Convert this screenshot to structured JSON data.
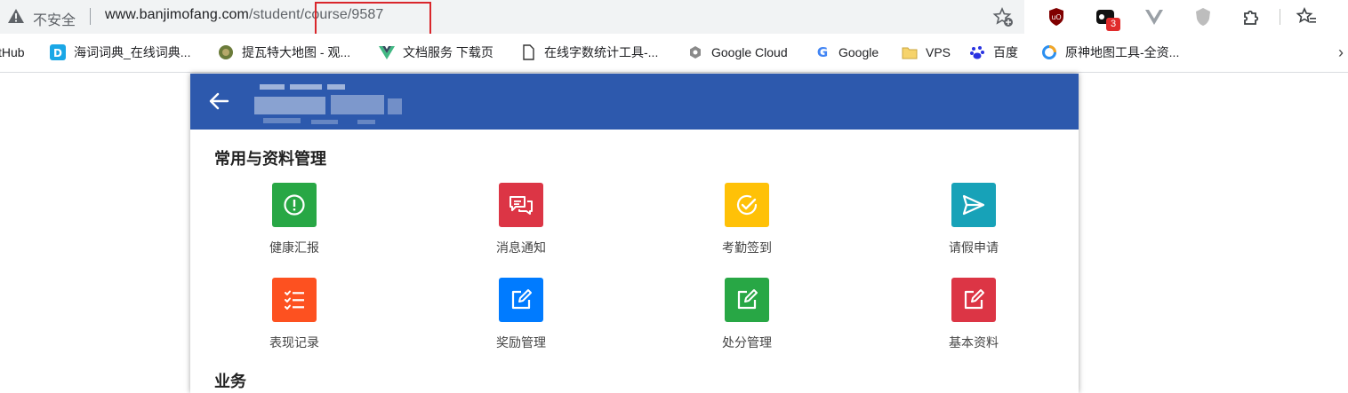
{
  "browser": {
    "security_label": "不安全",
    "url_host": "www.banjimofang.com",
    "url_path": "/student/course/9587",
    "extension_badge": "3"
  },
  "bookmarks": [
    {
      "label": "tHub",
      "icon": "github-icon"
    },
    {
      "label": "海词词典_在线词典...",
      "icon": "dict-icon"
    },
    {
      "label": "提瓦特大地图 - 观...",
      "icon": "map-icon"
    },
    {
      "label": "文档服务 下载页",
      "icon": "vue-icon"
    },
    {
      "label": "在线字数统计工具-...",
      "icon": "page-icon"
    },
    {
      "label": "Google Cloud",
      "icon": "cloud-icon"
    },
    {
      "label": "Google",
      "icon": "google-icon"
    },
    {
      "label": "VPS",
      "icon": "folder-icon"
    },
    {
      "label": "百度",
      "icon": "baidu-icon"
    },
    {
      "label": "原神地图工具-全资...",
      "icon": "ring-icon"
    }
  ],
  "app": {
    "section1_title": "常用与资料管理",
    "section2_title": "业务",
    "tiles": [
      {
        "label": "健康汇报",
        "color": "#28a745",
        "icon": "exclamation-circle-icon"
      },
      {
        "label": "消息通知",
        "color": "#dc3545",
        "icon": "chat-bubbles-icon"
      },
      {
        "label": "考勤签到",
        "color": "#ffc107",
        "icon": "check-circle-icon"
      },
      {
        "label": "请假申请",
        "color": "#17a2b8",
        "icon": "send-icon"
      },
      {
        "label": "表现记录",
        "color": "#fd5120",
        "icon": "checklist-icon"
      },
      {
        "label": "奖励管理",
        "color": "#007bff",
        "icon": "edit-icon"
      },
      {
        "label": "处分管理",
        "color": "#28a745",
        "icon": "edit-icon"
      },
      {
        "label": "基本资料",
        "color": "#dc3545",
        "icon": "edit-icon"
      }
    ],
    "header_color": "#2d59ad"
  }
}
